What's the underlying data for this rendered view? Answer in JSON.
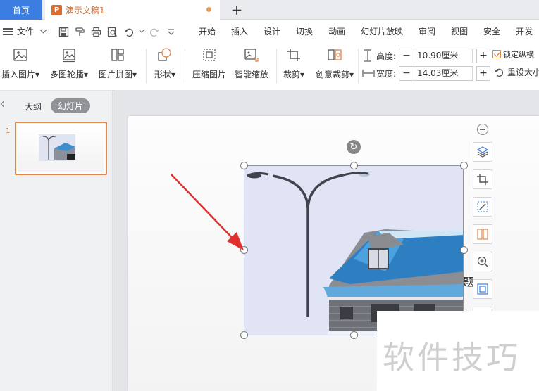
{
  "tabs": {
    "home_label": "首页",
    "doc_title": "演示文稿1",
    "doc_icon_letter": "P",
    "add_label": "+"
  },
  "menu": {
    "file_label": "文件",
    "items": [
      "开始",
      "插入",
      "设计",
      "切换",
      "动画",
      "幻灯片放映",
      "审阅",
      "视图",
      "安全",
      "开发"
    ]
  },
  "ribbon": {
    "insert_picture": "插入图片",
    "multi_carousel": "多图轮播",
    "picture_collage": "图片拼图",
    "shape": "形状",
    "compress_picture": "压缩图片",
    "smart_zoom": "智能缩放",
    "crop": "裁剪",
    "creative_crop": "创意裁剪",
    "height_label": "高度:",
    "height_value": "10.90厘米",
    "width_label": "宽度:",
    "width_value": "14.03厘米",
    "lock_label": "锁定纵横",
    "reset_label": "重设大小",
    "minus": "−",
    "plus": "+"
  },
  "panel": {
    "outline_tab": "大纲",
    "slides_tab": "幻灯片",
    "slide_number": "1"
  },
  "slide": {
    "side_char": "题"
  },
  "watermark": {
    "text": "软件技巧"
  },
  "colors": {
    "accent_blue": "#3b7de0",
    "accent_orange": "#e3874a",
    "arrow_red": "#e0302e"
  }
}
